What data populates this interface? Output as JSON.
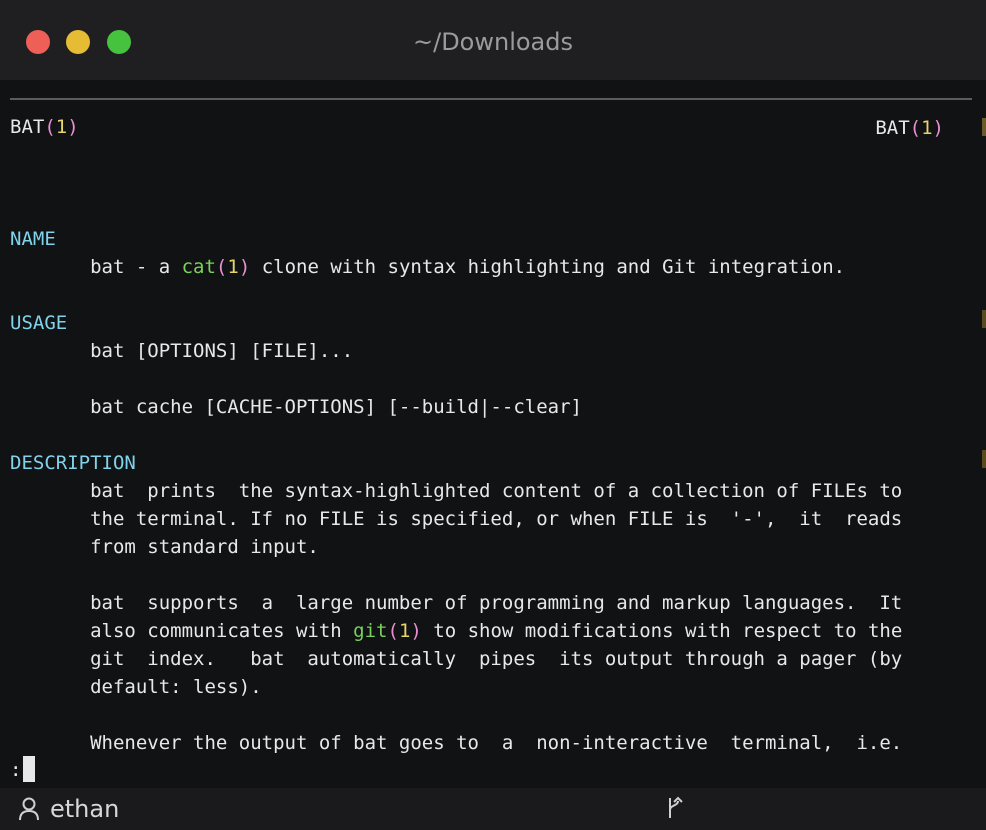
{
  "window": {
    "title": "~/Downloads"
  },
  "man": {
    "header_left": {
      "name": "BAT",
      "open": "(",
      "section": "1",
      "close": ")"
    },
    "header_right": {
      "name": "BAT",
      "open": "(",
      "section": "1",
      "close": ")"
    },
    "name_heading": "NAME",
    "name_line": {
      "pre": "       bat - a ",
      "ref": "cat",
      "open": "(",
      "section": "1",
      "close": ")",
      "post": " clone with syntax highlighting and Git integration."
    },
    "usage_heading": "USAGE",
    "usage_1": "       bat [OPTIONS] [FILE]...",
    "usage_2": "       bat cache [CACHE-OPTIONS] [--build|--clear]",
    "description_heading": "DESCRIPTION",
    "desc_1": "       bat  prints  the syntax-highlighted content of a collection of FILEs to",
    "desc_2": "       the terminal. If no FILE is specified, or when FILE is  '-',  it  reads",
    "desc_3": "       from standard input.",
    "desc_4": "       bat  supports  a  large number of programming and markup languages.  It",
    "desc_5": {
      "pre": "       also communicates with ",
      "ref": "git",
      "open": "(",
      "section": "1",
      "close": ")",
      "post": " to show modifications with respect to the"
    },
    "desc_6": "       git  index.   bat  automatically  pipes  its output through a pager (by",
    "desc_7": "       default: less).",
    "desc_8": "       Whenever the output of bat goes to  a  non-interactive  terminal,  i.e.",
    "prompt": ":"
  },
  "statusbar": {
    "user": "ethan",
    "user_icon": "person-icon",
    "branch_icon": "git-branch-icon"
  },
  "colors": {
    "heading": "#80d3ea",
    "paren": "#e98fd0",
    "section": "#e7d46c",
    "reference": "#7ad15c"
  }
}
